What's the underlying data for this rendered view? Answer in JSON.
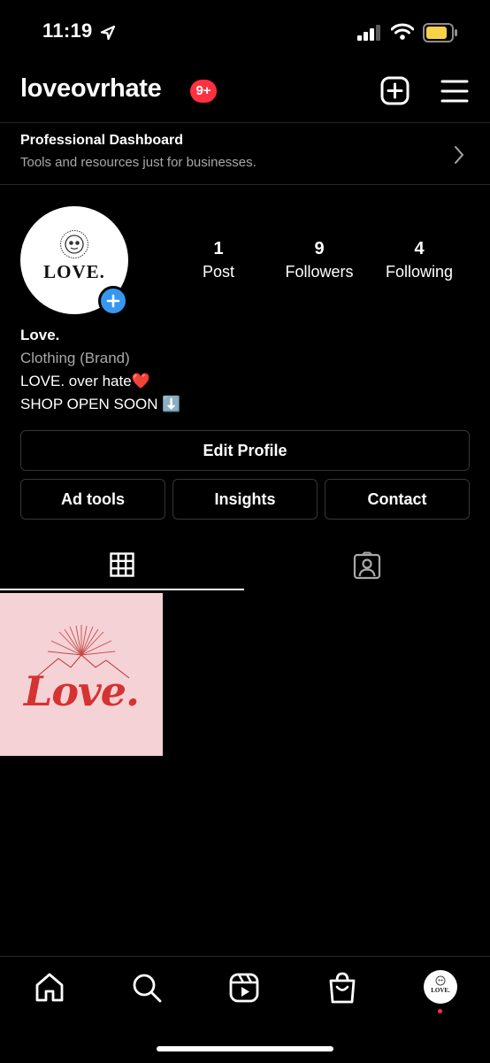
{
  "status_bar": {
    "time": "11:19"
  },
  "header": {
    "username": "loveovrhate",
    "badge": "9+"
  },
  "dashboard": {
    "title": "Professional Dashboard",
    "subtitle": "Tools and resources just for businesses."
  },
  "profile": {
    "avatar_text": "LOVE.",
    "stats": [
      {
        "value": "1",
        "label": "Post"
      },
      {
        "value": "9",
        "label": "Followers"
      },
      {
        "value": "4",
        "label": "Following"
      }
    ],
    "name": "Love.",
    "category": "Clothing (Brand)",
    "bio_line1": "LOVE. over hate❤️",
    "bio_line2": "SHOP OPEN SOON ⬇️"
  },
  "buttons": {
    "edit_profile": "Edit Profile",
    "ad_tools": "Ad tools",
    "insights": "Insights",
    "contact": "Contact"
  },
  "post": {
    "text": "Love."
  },
  "nav_avatar_text": "LOVE.",
  "colors": {
    "background": "#000000",
    "badge": "#ff3040",
    "add_button": "#3797f0",
    "post_bg": "#f5d2d6",
    "post_text": "#d63232"
  }
}
